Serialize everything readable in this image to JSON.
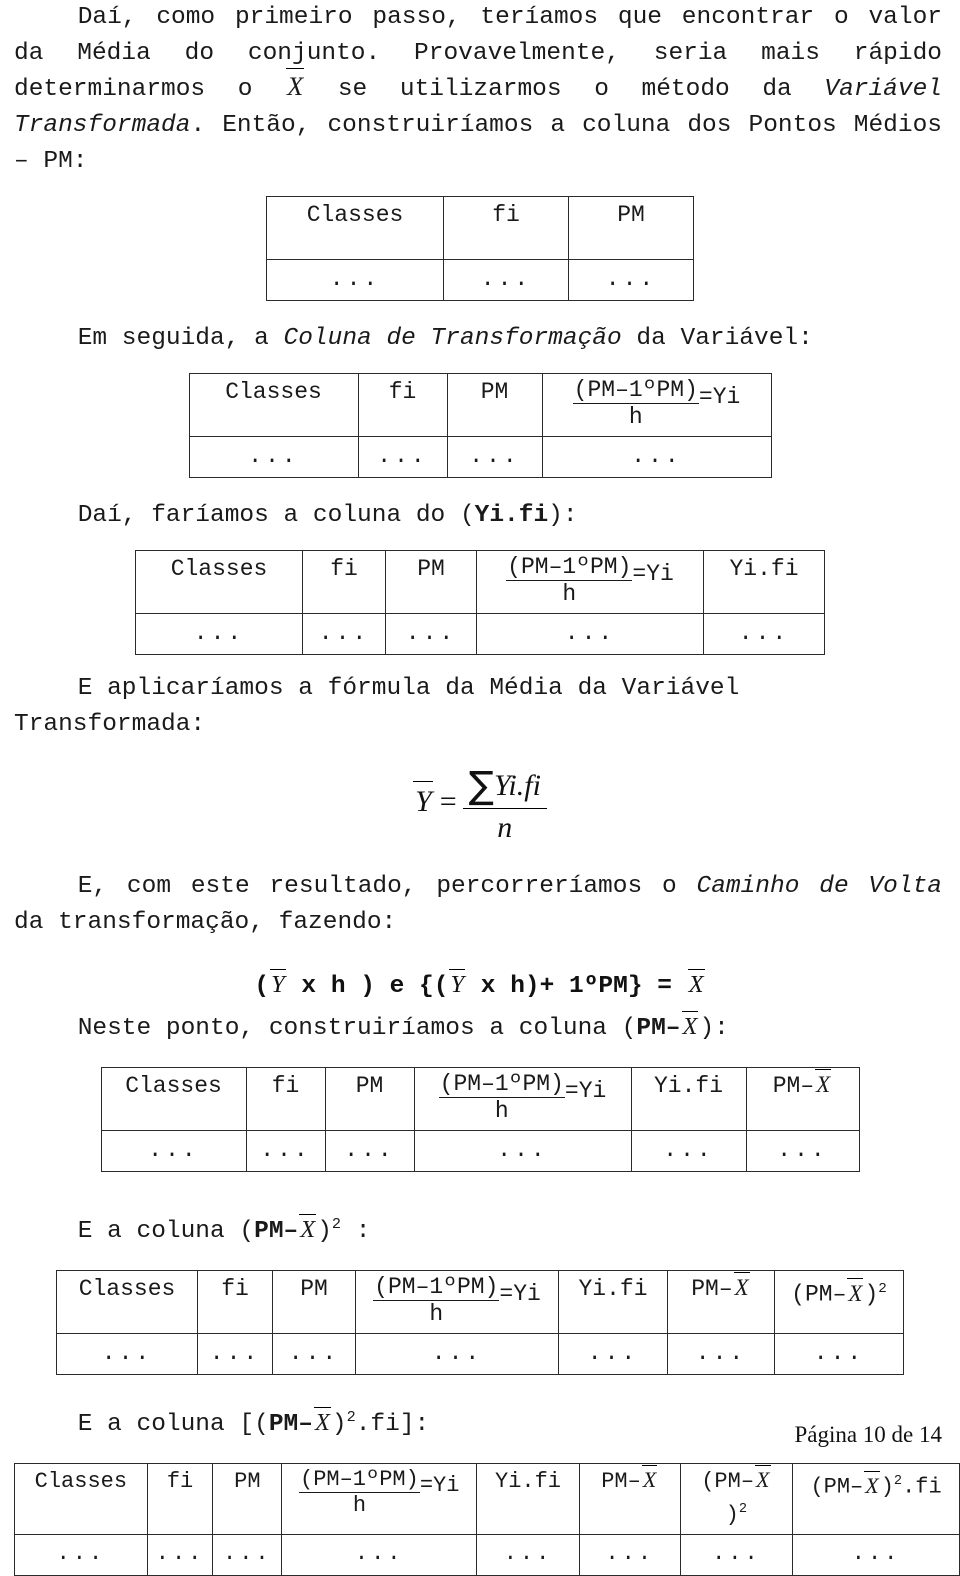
{
  "document": {
    "page_footer": "Página 10 de 14",
    "paragraphs": {
      "p1_a": "Daí, como primeiro passo, teríamos que encontrar o valor da Média do conjunto. Provavelmente, seria mais rápido determinarmos o ",
      "p1_xbar": "X",
      "p1_b": " se utilizarmos o método da ",
      "p1_italic": "Variável Transformada",
      "p1_c": ". Então, construiríamos a coluna dos Pontos Médios – PM:",
      "p2_a": "Em seguida,  a ",
      "p2_italic": "Coluna de Transformação",
      "p2_b": " da Variável:",
      "p3_a": "Daí, faríamos a coluna do (",
      "p3_bold": "Yi.fi",
      "p3_b": "):",
      "p4": "E aplicaríamos a fórmula da Média da Variável Transformada:",
      "p5_a": "E, com este resultado, percorreríamos o ",
      "p5_italic": "Caminho de Volta",
      "p5_b": " da transformação, fazendo:",
      "p6_a": "Neste ponto, construiríamos a coluna (",
      "p6_bold": "PM–",
      "p6_xbar": "X",
      "p6_b": "):",
      "p7_a": "E a coluna (",
      "p7_bold": "PM–",
      "p7_xbar": "X",
      "p7_b": ")",
      "p7_exp": "2",
      "p7_c": " :",
      "p8_a": "E a coluna [(",
      "p8_bold": "PM–",
      "p8_xbar": "X",
      "p8_b": ")",
      "p8_exp": "2",
      "p8_c": ".fi]:"
    },
    "formula_mean": {
      "lhs": "Y",
      "equals": "=",
      "numerator_sigma": "∑",
      "numerator": "Yi.fi",
      "denominator": "n"
    },
    "formula_return": {
      "open": "(",
      "ybar1": "Y",
      "mid1": " x h )",
      "e": "  e  {(",
      "ybar2": "Y",
      "mid2": " x h)+ 1ºPM} = ",
      "xbar": "X"
    },
    "headers": {
      "classes": "Classes",
      "fi": "fi",
      "pm": "PM",
      "yi_num": "(PM–1ºPM)",
      "yi_den": "h",
      "yi_eq": "=Yi",
      "yifi": "Yi.fi",
      "pm_minus_x_pre": "PM–",
      "pm_minus_x_var": "X",
      "sq_open": "(PM–",
      "sq_var": "X",
      "sq_close": ")",
      "sq_exp": "2",
      "sq_fi_close": ")",
      "sq_fi_exp": "2",
      "sq_fi_suffix": ".fi"
    },
    "cell_dots": "...",
    "tables": [
      {
        "id": "table-pm",
        "columns": [
          "Classes",
          "fi",
          "PM"
        ],
        "rows": [
          [
            "...",
            "...",
            "..."
          ]
        ]
      },
      {
        "id": "table-transform",
        "columns": [
          "Classes",
          "fi",
          "PM",
          "(PM–1ºPM)/h =Yi"
        ],
        "rows": [
          [
            "...",
            "...",
            "...",
            "..."
          ]
        ]
      },
      {
        "id": "table-yifi",
        "columns": [
          "Classes",
          "fi",
          "PM",
          "(PM–1ºPM)/h =Yi",
          "Yi.fi"
        ],
        "rows": [
          [
            "...",
            "...",
            "...",
            "...",
            "..."
          ]
        ]
      },
      {
        "id": "table-pm-minus-xbar",
        "columns": [
          "Classes",
          "fi",
          "PM",
          "(PM–1ºPM)/h =Yi",
          "Yi.fi",
          "PM–X"
        ],
        "rows": [
          [
            "...",
            "...",
            "...",
            "...",
            "...",
            "..."
          ]
        ]
      },
      {
        "id": "table-pm-minus-xbar-squared",
        "columns": [
          "Classes",
          "fi",
          "PM",
          "(PM–1ºPM)/h =Yi",
          "Yi.fi",
          "PM–X",
          "(PM–X)2"
        ],
        "rows": [
          [
            "...",
            "...",
            "...",
            "...",
            "...",
            "...",
            "..."
          ]
        ]
      },
      {
        "id": "table-pm-minus-xbar-squared-fi",
        "columns": [
          "Classes",
          "fi",
          "PM",
          "(PM–1ºPM)/h =Yi",
          "Yi.fi",
          "PM–X",
          "(PM–X)2",
          "(PM–X)2.fi"
        ],
        "rows": [
          [
            "...",
            "...",
            "...",
            "...",
            "...",
            "...",
            "...",
            "..."
          ]
        ]
      }
    ]
  }
}
